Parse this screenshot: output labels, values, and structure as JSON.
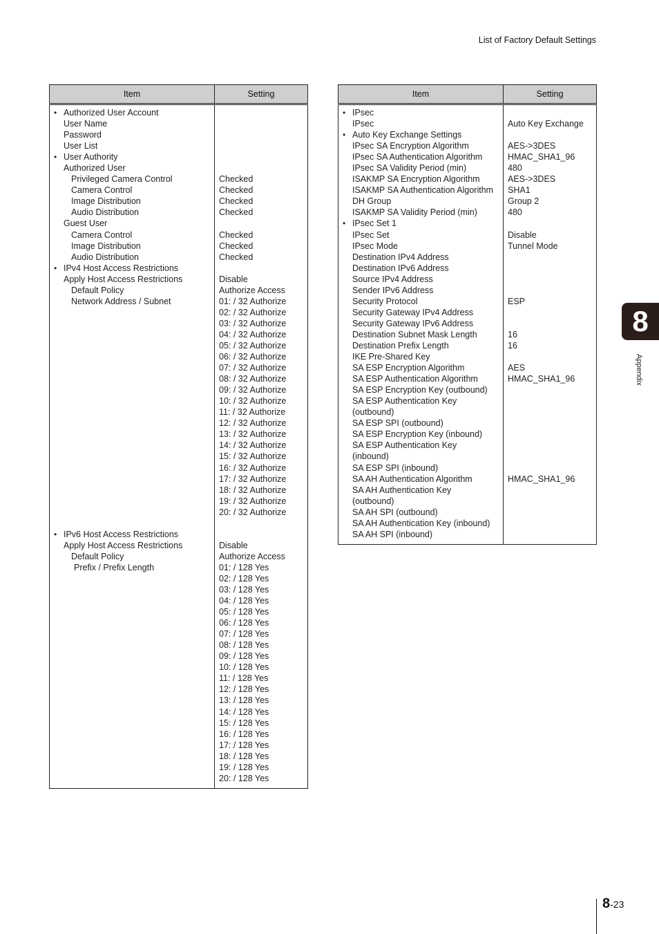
{
  "header": {
    "running_title": "List of Factory Default Settings"
  },
  "chapter_tab": {
    "number": "8",
    "label": "Appendix"
  },
  "footer": {
    "chapter": "8",
    "page": "-23"
  },
  "left_table": {
    "columns": [
      "Item",
      "Setting"
    ],
    "items": [
      {
        "text": "Authorized User Account",
        "level": "bullet"
      },
      {
        "text": "User Name",
        "level": "l1"
      },
      {
        "text": "Password",
        "level": "l1"
      },
      {
        "text": "User List",
        "level": "l1"
      },
      {
        "text": "User Authority",
        "level": "bullet"
      },
      {
        "text": "Authorized User",
        "level": "l1"
      },
      {
        "text": "Privileged Camera Control",
        "level": "l2"
      },
      {
        "text": "Camera Control",
        "level": "l2"
      },
      {
        "text": "Image Distribution",
        "level": "l2"
      },
      {
        "text": "Audio Distribution",
        "level": "l2"
      },
      {
        "text": "Guest User",
        "level": "l1"
      },
      {
        "text": "Camera Control",
        "level": "l2"
      },
      {
        "text": "Image Distribution",
        "level": "l2"
      },
      {
        "text": "Audio Distribution",
        "level": "l2"
      },
      {
        "text": "IPv4 Host Access Restrictions",
        "level": "bullet"
      },
      {
        "text": "Apply Host Access Restrictions",
        "level": "l1"
      },
      {
        "text": "Default Policy",
        "level": "l2"
      },
      {
        "text": "Network Address / Subnet",
        "level": "l2"
      },
      {
        "text": "",
        "level": "l1"
      },
      {
        "text": "",
        "level": "l1"
      },
      {
        "text": "",
        "level": "l1"
      },
      {
        "text": "",
        "level": "l1"
      },
      {
        "text": "",
        "level": "l1"
      },
      {
        "text": "",
        "level": "l1"
      },
      {
        "text": "",
        "level": "l1"
      },
      {
        "text": "",
        "level": "l1"
      },
      {
        "text": "",
        "level": "l1"
      },
      {
        "text": "",
        "level": "l1"
      },
      {
        "text": "",
        "level": "l1"
      },
      {
        "text": "",
        "level": "l1"
      },
      {
        "text": "",
        "level": "l1"
      },
      {
        "text": "",
        "level": "l1"
      },
      {
        "text": "",
        "level": "l1"
      },
      {
        "text": "",
        "level": "l1"
      },
      {
        "text": "",
        "level": "l1"
      },
      {
        "text": "",
        "level": "l1"
      },
      {
        "text": "",
        "level": "l1"
      },
      {
        "text": "",
        "level": "l1"
      },
      {
        "text": "IPv6 Host Access Restrictions",
        "level": "bullet"
      },
      {
        "text": "Apply Host Access Restrictions",
        "level": "l1"
      },
      {
        "text": "Default Policy",
        "level": "l2"
      },
      {
        "text": "Prefix / Prefix Length",
        "level": "l3"
      }
    ],
    "settings": [
      "",
      "",
      "",
      "",
      "",
      "",
      "Checked",
      "Checked",
      "Checked",
      "Checked",
      "",
      "Checked",
      "Checked",
      "Checked",
      "",
      "Disable",
      "Authorize Access",
      "01: / 32 Authorize",
      "02: / 32 Authorize",
      "03: / 32 Authorize",
      "04: / 32 Authorize",
      "05: / 32 Authorize",
      "06: / 32 Authorize",
      "07: / 32 Authorize",
      "08: / 32 Authorize",
      "09: / 32 Authorize",
      "10: / 32 Authorize",
      "11: / 32 Authorize",
      "12: / 32 Authorize",
      "13: / 32 Authorize",
      "14: / 32 Authorize",
      "15: / 32 Authorize",
      "16: / 32 Authorize",
      "17: / 32 Authorize",
      "18: / 32 Authorize",
      "19: / 32 Authorize",
      "20: / 32 Authorize",
      "",
      "",
      "Disable",
      "Authorize Access",
      "01: / 128 Yes",
      "02: / 128 Yes",
      "03: / 128 Yes",
      "04: / 128 Yes",
      "05: / 128 Yes",
      "06: / 128 Yes",
      "07: / 128 Yes",
      "08: / 128 Yes",
      "09: / 128 Yes",
      "10: / 128 Yes",
      "11: / 128 Yes",
      "12: / 128 Yes",
      "13: / 128 Yes",
      "14: / 128 Yes",
      "15: / 128 Yes",
      "16: / 128 Yes",
      "17: / 128 Yes",
      "18: / 128 Yes",
      "19: / 128 Yes",
      "20: / 128 Yes"
    ]
  },
  "right_table": {
    "columns": [
      "Item",
      "Setting"
    ],
    "items": [
      {
        "text": "IPsec",
        "level": "bullet"
      },
      {
        "text": "IPsec",
        "level": "l1"
      },
      {
        "text": "Auto Key Exchange Settings",
        "level": "bullet"
      },
      {
        "text": "IPsec SA Encryption Algorithm",
        "level": "l1"
      },
      {
        "text": "IPsec SA Authentication Algorithm",
        "level": "l1"
      },
      {
        "text": "IPsec SA Validity Period (min)",
        "level": "l1"
      },
      {
        "text": "ISAKMP SA Encryption Algorithm",
        "level": "l1"
      },
      {
        "text": "ISAKMP SA Authentication Algorithm",
        "level": "l1"
      },
      {
        "text": "DH Group",
        "level": "l1"
      },
      {
        "text": "ISAKMP SA Validity Period (min)",
        "level": "l1"
      },
      {
        "text": "IPsec Set 1",
        "level": "bullet"
      },
      {
        "text": "IPsec Set",
        "level": "l1"
      },
      {
        "text": "IPsec Mode",
        "level": "l1"
      },
      {
        "text": "Destination IPv4 Address",
        "level": "l1"
      },
      {
        "text": "Destination IPv6 Address",
        "level": "l1"
      },
      {
        "text": "Source IPv4 Address",
        "level": "l1"
      },
      {
        "text": "Sender IPv6 Address",
        "level": "l1"
      },
      {
        "text": "Security Protocol",
        "level": "l1"
      },
      {
        "text": "Security Gateway IPv4 Address",
        "level": "l1"
      },
      {
        "text": "Security Gateway IPv6 Address",
        "level": "l1"
      },
      {
        "text": "Destination Subnet Mask Length",
        "level": "l1"
      },
      {
        "text": "Destination Prefix Length",
        "level": "l1"
      },
      {
        "text": "IKE Pre-Shared Key",
        "level": "l1"
      },
      {
        "text": "SA ESP Encryption Algorithm",
        "level": "l1"
      },
      {
        "text": "SA ESP Authentication Algorithm",
        "level": "l1"
      },
      {
        "text": "SA ESP Encryption Key (outbound)",
        "level": "l1"
      },
      {
        "text": "SA ESP Authentication Key",
        "level": "l1"
      },
      {
        "text": "(outbound)",
        "level": "l1"
      },
      {
        "text": "SA ESP SPI (outbound)",
        "level": "l1"
      },
      {
        "text": "SA ESP Encryption Key (inbound)",
        "level": "l1"
      },
      {
        "text": "SA ESP Authentication Key",
        "level": "l1"
      },
      {
        "text": "(inbound)",
        "level": "l1"
      },
      {
        "text": "SA ESP SPI (inbound)",
        "level": "l1"
      },
      {
        "text": "SA AH Authentication Algorithm",
        "level": "l1"
      },
      {
        "text": "SA AH Authentication Key",
        "level": "l1"
      },
      {
        "text": "(outbound)",
        "level": "l1"
      },
      {
        "text": "SA AH SPI (outbound)",
        "level": "l1"
      },
      {
        "text": "SA AH Authentication Key (inbound)",
        "level": "l1"
      },
      {
        "text": "SA AH SPI (inbound)",
        "level": "l1"
      }
    ],
    "settings": [
      "",
      "Auto Key Exchange",
      "",
      "AES->3DES",
      "HMAC_SHA1_96",
      "480",
      "AES->3DES",
      "SHA1",
      "Group 2",
      "480",
      "",
      "Disable",
      "Tunnel Mode",
      "",
      "",
      "",
      "",
      "ESP",
      "",
      "",
      "16",
      "16",
      "",
      "AES",
      "HMAC_SHA1_96",
      "",
      "",
      "",
      "",
      "",
      "",
      "",
      "",
      "HMAC_SHA1_96",
      "",
      "",
      "",
      "",
      ""
    ]
  }
}
